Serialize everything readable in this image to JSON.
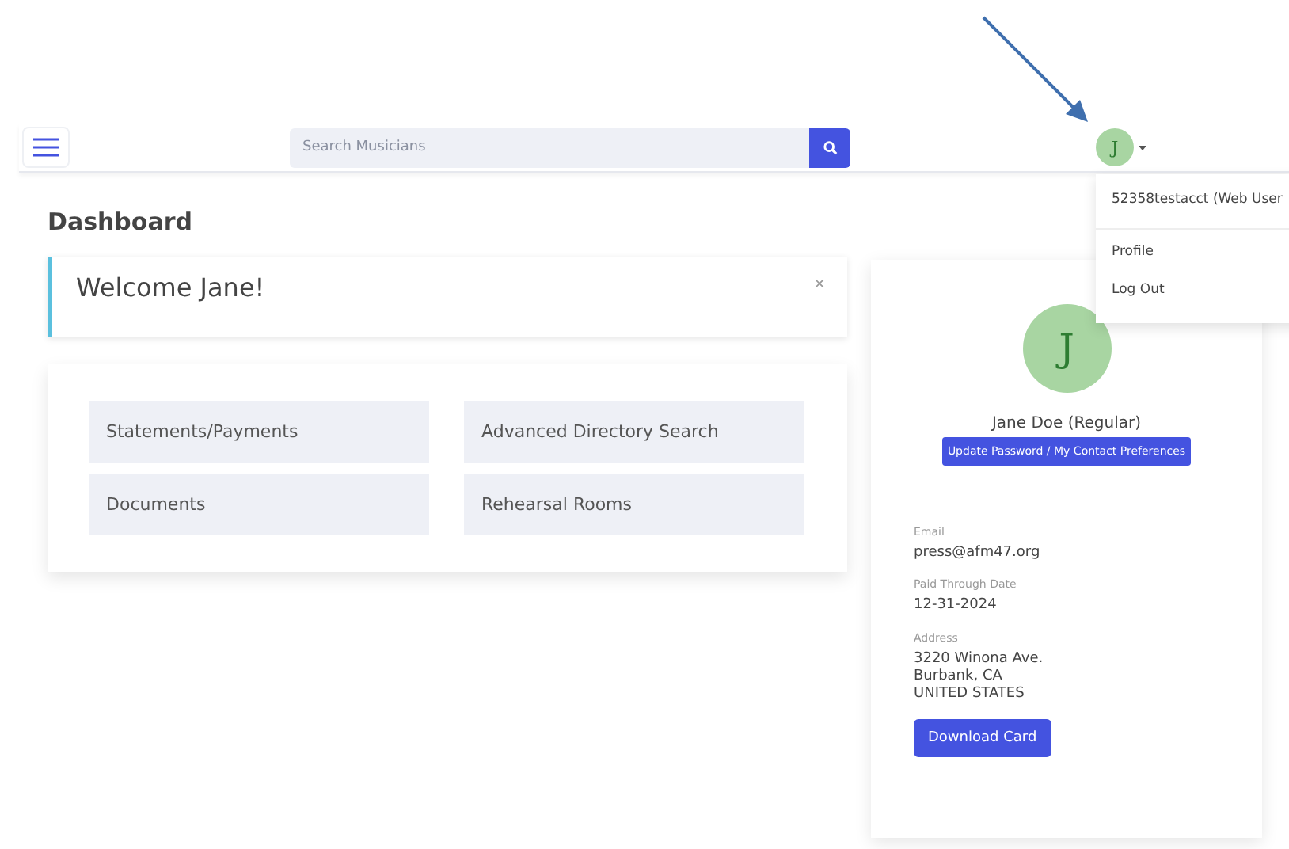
{
  "navbar": {
    "search": {
      "placeholder": "Search Musicians"
    },
    "avatar_initial": "J"
  },
  "user_menu": {
    "expanded": true,
    "items": [
      {
        "label": "52358testacct (Web User"
      },
      {
        "label": "Profile"
      },
      {
        "label": "Log Out"
      }
    ]
  },
  "page_title": "Dashboard",
  "welcome": {
    "message": "Welcome Jane!",
    "close": "×"
  },
  "tiles": [
    {
      "label": "Statements/Payments"
    },
    {
      "label": "Advanced Directory Search"
    },
    {
      "label": "Documents"
    },
    {
      "label": "Rehearsal Rooms"
    }
  ],
  "profile": {
    "initial": "J",
    "name": "Jane Doe (Regular)",
    "update_button": "Update Password / My Contact Preferences",
    "fields": [
      {
        "label": "Email",
        "lines": [
          "press@afm47.org"
        ]
      },
      {
        "label": "Paid Through Date",
        "lines": [
          "12-31-2024"
        ]
      },
      {
        "label": "Address",
        "lines": [
          "3220 Winona Ave.",
          "Burbank, CA",
          "UNITED STATES"
        ]
      }
    ],
    "download_button": "Download Card"
  }
}
